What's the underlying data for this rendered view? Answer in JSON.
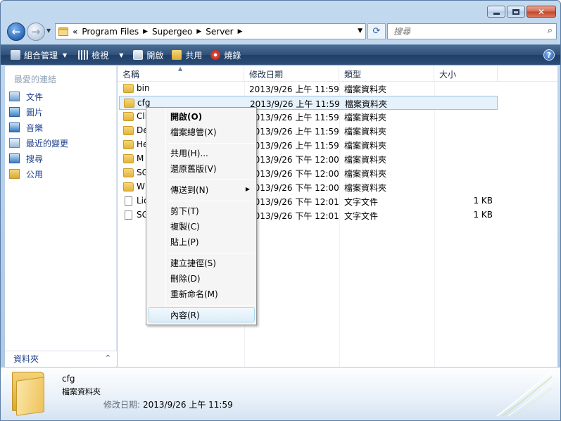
{
  "window": {
    "caption_buttons": [
      "minimize",
      "maximize",
      "close"
    ]
  },
  "nav": {
    "back_glyph": "←",
    "forward_glyph": "→",
    "address": {
      "overflow": "«",
      "crumbs": [
        "Program Files",
        "Supergeo",
        "Server"
      ]
    },
    "search_placeholder": "搜尋"
  },
  "toolbar": {
    "organize": "組合管理",
    "views": "檢視",
    "open": "開啟",
    "share": "共用",
    "burn": "燒錄",
    "help": "?"
  },
  "navpane": {
    "favorites_title": "最愛的連結",
    "items": [
      {
        "label": "文件",
        "icon": "documents-icon"
      },
      {
        "label": "圖片",
        "icon": "pictures-icon"
      },
      {
        "label": "音樂",
        "icon": "music-icon"
      },
      {
        "label": "最近的變更",
        "icon": "recent-changes-icon"
      },
      {
        "label": "搜尋",
        "icon": "search-folder-icon"
      },
      {
        "label": "公用",
        "icon": "public-folder-icon"
      }
    ],
    "folders_label": "資料夾"
  },
  "columns": {
    "name": "名稱",
    "date": "修改日期",
    "type": "類型",
    "size": "大小"
  },
  "files": [
    {
      "name": "bin",
      "date": "2013/9/26 上午 11:59",
      "type": "檔案資料夾",
      "size": "",
      "kind": "folder"
    },
    {
      "name": "cfg",
      "date": "2013/9/26 上午 11:59",
      "type": "檔案資料夾",
      "size": "",
      "kind": "folder"
    },
    {
      "name": "Cli",
      "date": "2013/9/26 上午 11:59",
      "type": "檔案資料夾",
      "size": "",
      "kind": "folder"
    },
    {
      "name": "De",
      "date": "2013/9/26 上午 11:59",
      "type": "檔案資料夾",
      "size": "",
      "kind": "folder"
    },
    {
      "name": "He",
      "date": "2013/9/26 上午 11:59",
      "type": "檔案資料夾",
      "size": "",
      "kind": "folder"
    },
    {
      "name": "M",
      "date": "2013/9/26 下午 12:00",
      "type": "檔案資料夾",
      "size": "",
      "kind": "folder"
    },
    {
      "name": "SG",
      "date": "2013/9/26 下午 12:00",
      "type": "檔案資料夾",
      "size": "",
      "kind": "folder"
    },
    {
      "name": "W",
      "date": "2013/9/26 下午 12:00",
      "type": "檔案資料夾",
      "size": "",
      "kind": "folder"
    },
    {
      "name": "Lic",
      "date": "2013/9/26 下午 12:01",
      "type": "文字文件",
      "size": "1 KB",
      "kind": "file"
    },
    {
      "name": "SG",
      "date": "2013/9/26 下午 12:01",
      "type": "文字文件",
      "size": "1 KB",
      "kind": "file"
    }
  ],
  "context_menu": {
    "open": "開啟(O)",
    "file_manager": "檔案總管(X)",
    "share": "共用(H)...",
    "restore": "還原舊版(V)",
    "send_to": "傳送到(N)",
    "cut": "剪下(T)",
    "copy": "複製(C)",
    "paste": "貼上(P)",
    "shortcut": "建立捷徑(S)",
    "delete": "刪除(D)",
    "rename": "重新命名(M)",
    "properties": "內容(R)"
  },
  "details": {
    "name": "cfg",
    "type": "檔案資料夾",
    "modified_label": "修改日期:",
    "modified_value": "2013/9/26 上午 11:59"
  },
  "colors": {
    "toolbar": "#2b4c76",
    "link_text": "#1e3f8a",
    "selection": "#e5f1fb"
  }
}
